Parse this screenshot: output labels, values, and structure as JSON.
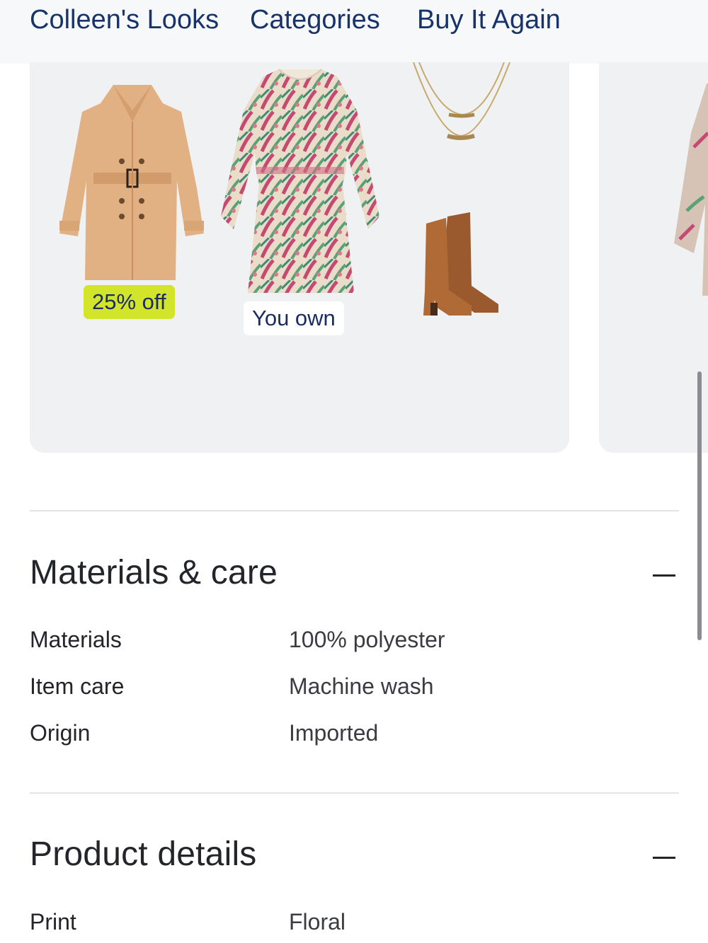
{
  "nav": {
    "links": [
      "Colleen's Looks",
      "Categories",
      "Buy It Again"
    ]
  },
  "looks": {
    "card1": {
      "items": [
        {
          "name": "trench coat",
          "badge": "25% off"
        },
        {
          "name": "floral dress",
          "badge": "You own"
        },
        {
          "name": "layered necklace",
          "badge": ""
        },
        {
          "name": "tall boots",
          "badge": ""
        }
      ]
    }
  },
  "materials": {
    "title": "Materials & care",
    "rows": [
      {
        "label": "Materials",
        "value": "100% polyester"
      },
      {
        "label": "Item care",
        "value": "Machine wash"
      },
      {
        "label": "Origin",
        "value": "Imported"
      }
    ]
  },
  "details": {
    "title": "Product details",
    "rows": [
      {
        "label": "Print",
        "value": "Floral"
      }
    ]
  },
  "colors": {
    "nav_text": "#18336a",
    "sale_badge": "#d2e52a",
    "card_bg": "#f0f1f3"
  }
}
